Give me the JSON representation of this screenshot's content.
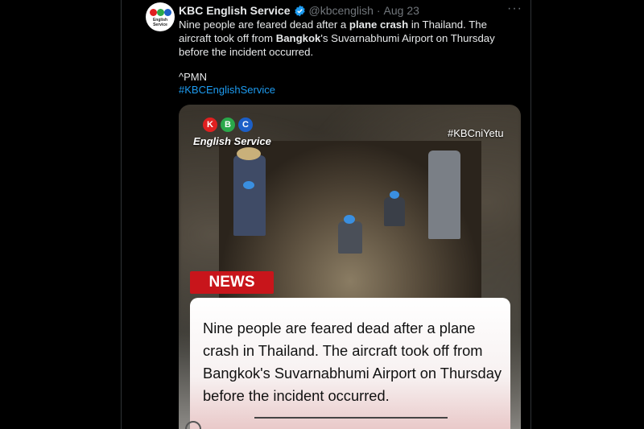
{
  "tweet": {
    "author": {
      "name": "KBC English Service",
      "handle": "@kbcenglish",
      "separator": "·",
      "date": "Aug 23",
      "avatar_text": "English Service"
    },
    "more_label": "···",
    "text": {
      "part1": "Nine people are feared dead after a ",
      "bold1": "plane crash",
      "part2": " in Thailand. The aircraft took off from ",
      "bold2": "Bangkok",
      "part3": "'s Suvarnabhumi Airport on Thursday before the incident occurred."
    },
    "signature": "^PMN",
    "hashtag": "#KBCEnglishService"
  },
  "media": {
    "logo_letters": [
      "K",
      "B",
      "C"
    ],
    "logo_colors": [
      "#e02020",
      "#2aa84a",
      "#1c5fc7"
    ],
    "logo_label": "English Service",
    "hashtag_overlay": "#KBCniYetu",
    "news_label": "NEWS",
    "caption": "Nine people are feared dead after a plane crash in Thailand. The aircraft took off from Bangkok's Suvarnabhumi Airport on Thursday before the incident occurred."
  },
  "colors": {
    "background": "#000000",
    "link": "#1d9bf0",
    "verified": "#1d9bf0",
    "news_red": "#c8151b"
  }
}
